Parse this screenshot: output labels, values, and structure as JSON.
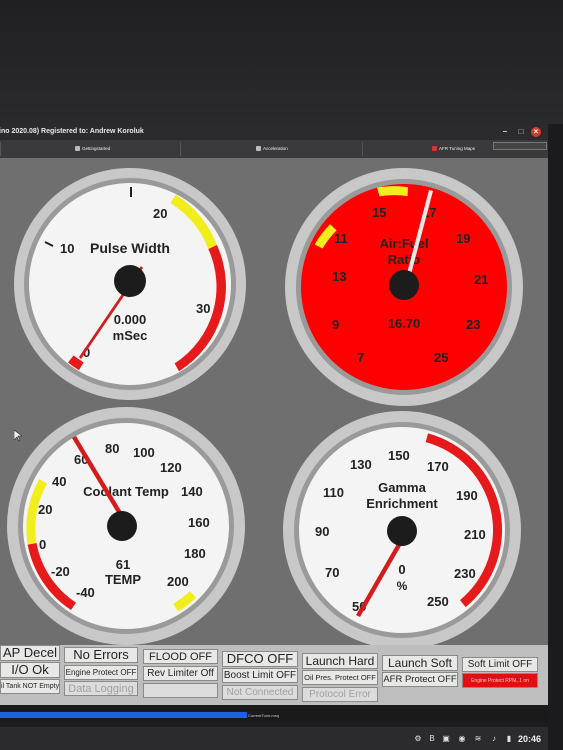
{
  "window": {
    "title": "ino 2020.08) Registered to: Andrew Koroluk"
  },
  "tabs": [
    {
      "label": "Gettingstarted"
    },
    {
      "label": "Acceleration"
    },
    {
      "label": "AFR Tuning Maps"
    }
  ],
  "gauges": {
    "pulse_width": {
      "title": "Pulse Width",
      "value": "0.000",
      "units": "mSec",
      "ticks": [
        "0",
        "10",
        "20",
        "30"
      ],
      "face": "#f4f4f4"
    },
    "afr": {
      "title_line1": "Air:Fuel",
      "title_line2": "Ratio",
      "value": "16.70",
      "ticks": [
        "7",
        "9",
        "11",
        "13",
        "15",
        "17",
        "19",
        "21",
        "23",
        "25"
      ],
      "face": "#ff0000"
    },
    "coolant": {
      "title": "Coolant Temp",
      "value": "61",
      "units": "TEMP",
      "ticks": [
        "-40",
        "-20",
        "0",
        "20",
        "40",
        "60",
        "80",
        "100",
        "120",
        "140",
        "160",
        "180",
        "200"
      ],
      "face": "#f4f4f4"
    },
    "gamma": {
      "title_line1": "Gamma",
      "title_line2": "Enrichment",
      "value": "0",
      "units": "%",
      "ticks": [
        "50",
        "70",
        "90",
        "110",
        "130",
        "150",
        "170",
        "190",
        "210",
        "230",
        "250"
      ],
      "face": "#f4f4f4"
    }
  },
  "indicators": {
    "row1": [
      "AP Decel",
      "No Errors",
      "FLOOD OFF",
      "DFCO OFF",
      "Launch Hard",
      "Launch Soft",
      "Soft Limit OFF"
    ],
    "row2": [
      "I/O Ok",
      "Engine Protect OFF",
      "Rev Limiter Off",
      "Boost Limit OFF",
      "Oil Pres. Protect OFF",
      "AFR Protect OFF",
      "Engine Protect RPM, 1 on"
    ],
    "row3": [
      "il Tank NOT Empty",
      "Data Logging",
      "",
      "Not Connected",
      "Protocol Error"
    ]
  },
  "status": {
    "file": "CurrentTune.msq",
    "progress": 0.45
  },
  "clock": "20:46",
  "colors": {
    "red": "#ff0000",
    "yellow": "#f2ee1c",
    "needle": "#d41c1c",
    "indicator_red": "#e01010"
  }
}
